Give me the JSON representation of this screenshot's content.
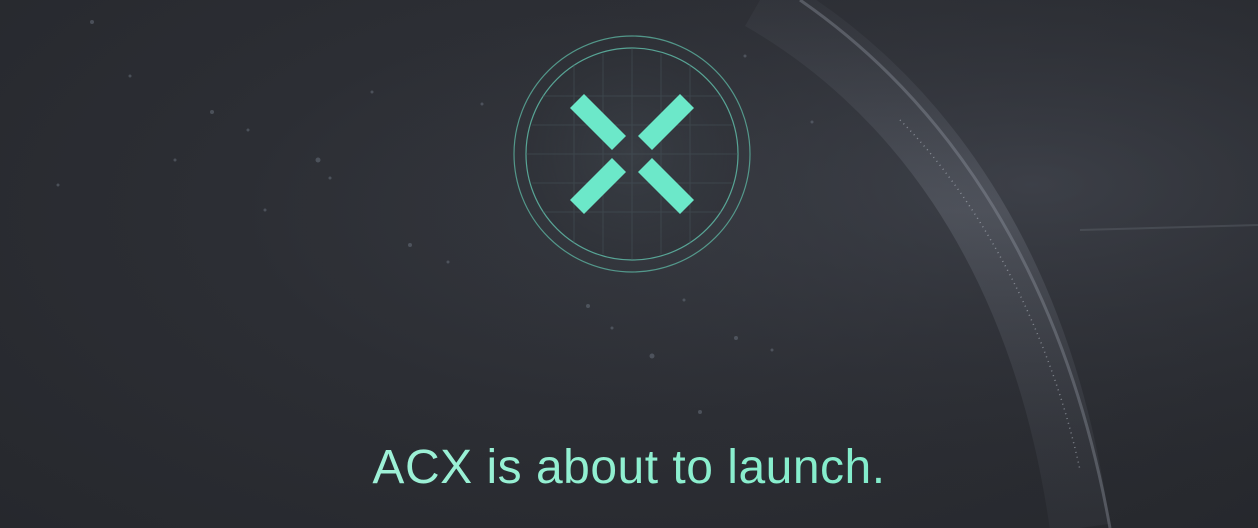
{
  "page": {
    "headline": "ACX is about to launch."
  },
  "logo": {
    "icon": "acx-cross-logo-icon",
    "accent_color": "#6ce8c9",
    "ring_color": "#5fb9a6"
  },
  "colors": {
    "background": "#2b2d33",
    "headline": "#8ef0d2"
  }
}
